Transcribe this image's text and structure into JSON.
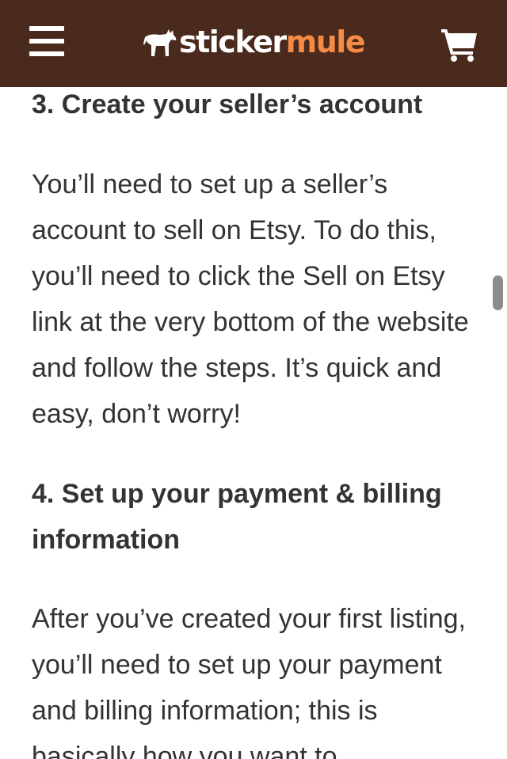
{
  "header": {
    "logo_part_a": "sticker",
    "logo_part_b": "mule",
    "menu_icon": "hamburger-menu-icon",
    "cart_icon": "shopping-cart-icon",
    "background_color": "#4a2a1c",
    "brand_accent": "#f58b45"
  },
  "article": {
    "sections": [
      {
        "heading": "3. Create your seller’s account",
        "body": "You’ll need to set up a seller’s account to sell on Etsy. To do this, you’ll need to click the Sell on Etsy link at the very bottom of the website and follow the steps. It’s quick and easy, don’t worry!"
      },
      {
        "heading": "4. Set up your payment & billing information",
        "body": "After you’ve created your first listing, you’ll need to set up your payment and billing information; this is basically how you want to"
      }
    ]
  },
  "scrollbar": {
    "position_fraction": 0.36
  }
}
